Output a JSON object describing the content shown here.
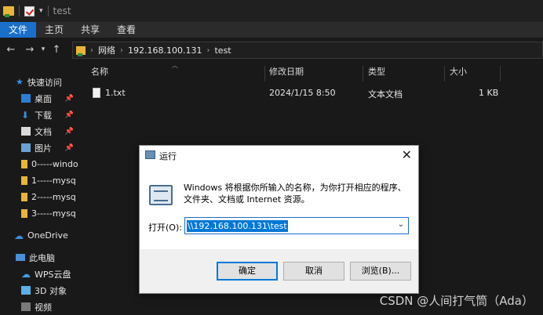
{
  "titlebar": {
    "title": "test"
  },
  "ribbon": {
    "tabs": [
      "文件",
      "主页",
      "共享",
      "查看"
    ]
  },
  "address": {
    "crumbs": [
      "网络",
      "192.168.100.131",
      "test"
    ]
  },
  "sidebar": {
    "quick_access": "快速访问",
    "items": [
      {
        "label": "桌面",
        "icon": "desktop-icon",
        "pinned": true
      },
      {
        "label": "下载",
        "icon": "download-icon",
        "pinned": true
      },
      {
        "label": "文档",
        "icon": "documents-icon",
        "pinned": true
      },
      {
        "label": "图片",
        "icon": "pictures-icon",
        "pinned": true
      },
      {
        "label": "0-----windo",
        "icon": "folder-icon"
      },
      {
        "label": "1-----mysq",
        "icon": "folder-icon"
      },
      {
        "label": "2-----mysq",
        "icon": "folder-icon"
      },
      {
        "label": "3-----mysq",
        "icon": "folder-icon"
      }
    ],
    "onedrive": "OneDrive",
    "this_pc": "此电脑",
    "pc_items": [
      {
        "label": "WPS云盘",
        "icon": "cloud-icon"
      },
      {
        "label": "3D 对象",
        "icon": "3d-objects-icon"
      },
      {
        "label": "视频",
        "icon": "video-icon"
      }
    ]
  },
  "columns": {
    "name": "名称",
    "date": "修改日期",
    "type": "类型",
    "size": "大小"
  },
  "files": [
    {
      "name": "1.txt",
      "date": "2024/1/15 8:50",
      "type": "文本文档",
      "size": "1 KB"
    }
  ],
  "dialog": {
    "title": "运行",
    "description": "Windows 将根据你所输入的名称，为你打开相应的程序、文件夹、文档或 Internet 资源。",
    "open_label": "打开(O):",
    "input_value": "\\\\192.168.100.131\\test",
    "ok": "确定",
    "cancel": "取消",
    "browse": "浏览(B)..."
  },
  "watermark": "CSDN @人间打气筒（Ada）",
  "colors": {
    "accent": "#1a6fc9",
    "selection": "#0078d7",
    "folder": "#e8b53a"
  }
}
